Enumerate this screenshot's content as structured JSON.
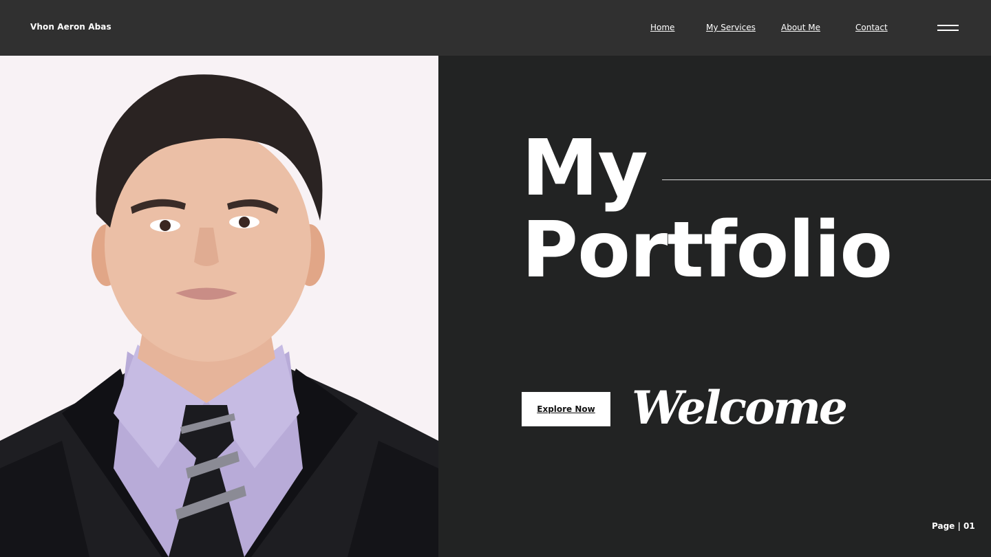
{
  "header": {
    "brand": "Vhon Aeron Abas",
    "nav": [
      "Home",
      "My Services",
      "About Me",
      "Contact"
    ],
    "menu_icon": "hamburger-menu-icon"
  },
  "hero": {
    "title_line1": "My",
    "title_line2": "Portfolio",
    "cta_label": "Explore Now",
    "script_text": "Welcome",
    "page_indicator": "Page | 01"
  },
  "colors": {
    "header_bg": "#303030",
    "main_bg": "#222323",
    "photo_bg": "#f8f2f5",
    "text": "#ffffff",
    "button_bg": "#ffffff"
  }
}
